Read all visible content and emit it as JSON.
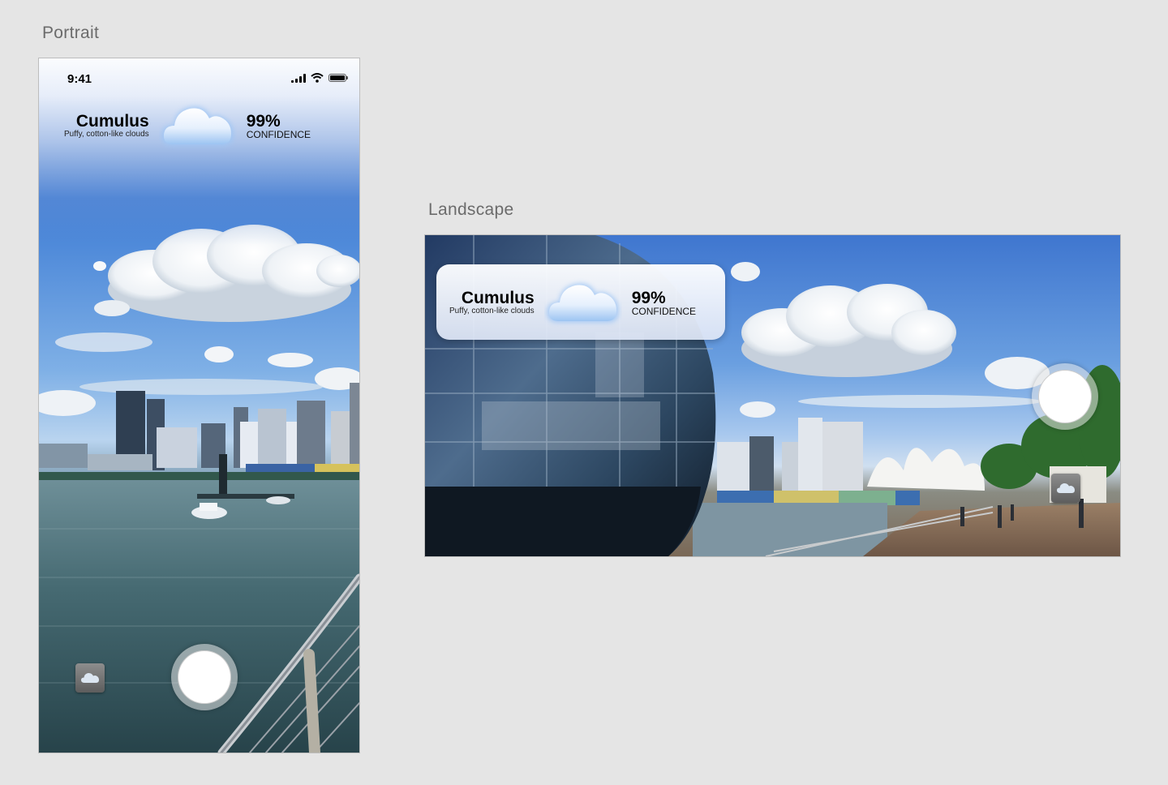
{
  "labels": {
    "portrait": "Portrait",
    "landscape": "Landscape"
  },
  "status_bar": {
    "time": "9:41"
  },
  "classification": {
    "name": "Cumulus",
    "description": "Puffy, cotton-like clouds",
    "confidence_value": "99%",
    "confidence_label": "CONFIDENCE",
    "icon": "cloud-icon"
  },
  "controls": {
    "shutter_icon": "shutter-button",
    "gallery_icon": "cloud-thumbnail-icon"
  },
  "colors": {
    "background": "#e5e5e5",
    "label_text": "#6b6b6b",
    "cloud_glow": "#9fc6f5",
    "sky": "#4a86d8"
  }
}
